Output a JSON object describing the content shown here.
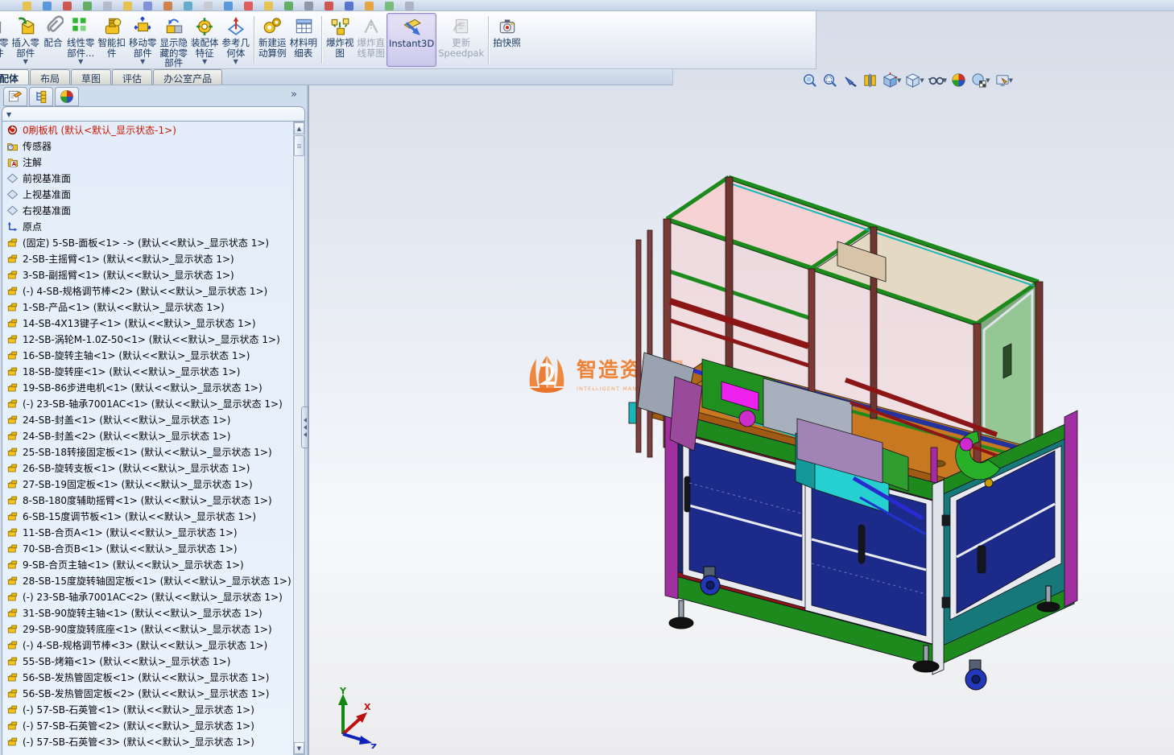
{
  "app": {
    "name": "SolidWorks assembly window"
  },
  "toolbar": {
    "buttons": [
      {
        "label": "编辑零部件",
        "display": "编辑零\n部件",
        "icon": "edit-component-icon",
        "state": "normal",
        "dropdown": false,
        "cut": true
      },
      {
        "label": "插入零部件",
        "display": "插入零\n部件",
        "icon": "insert-component-icon",
        "state": "normal",
        "dropdown": true,
        "cut": false
      },
      {
        "label": "配合",
        "display": "配合",
        "icon": "mate-icon",
        "state": "normal",
        "dropdown": false,
        "cut": false
      },
      {
        "label": "线性零部件...",
        "display": "线性零\n部件...",
        "icon": "linear-pattern-icon",
        "state": "normal",
        "dropdown": true,
        "cut": false
      },
      {
        "label": "智能扣件",
        "display": "智能扣\n件",
        "icon": "smart-fasteners-icon",
        "state": "normal",
        "dropdown": false,
        "cut": false
      },
      {
        "label": "移动零部件",
        "display": "移动零\n部件",
        "icon": "move-component-icon",
        "state": "normal",
        "dropdown": true,
        "cut": false
      },
      {
        "label": "显示隐藏的零部件",
        "display": "显示隐\n藏的零\n部件",
        "icon": "show-hidden-components-icon",
        "state": "normal",
        "dropdown": false,
        "cut": false
      },
      {
        "label": "装配体特征",
        "display": "装配体\n特征",
        "icon": "assembly-features-icon",
        "state": "normal",
        "dropdown": true,
        "cut": false
      },
      {
        "label": "参考几何体",
        "display": "参考几\n何体",
        "icon": "reference-geometry-icon",
        "state": "normal",
        "dropdown": true,
        "cut": false
      },
      {
        "sep": true
      },
      {
        "label": "新建运动算例",
        "display": "新建运\n动算例",
        "icon": "motion-study-icon",
        "state": "normal",
        "dropdown": false,
        "cut": false
      },
      {
        "label": "材料明细表",
        "display": "材料明\n细表",
        "icon": "bom-icon",
        "state": "normal",
        "dropdown": false,
        "cut": false
      },
      {
        "sep": true
      },
      {
        "label": "爆炸视图",
        "display": "爆炸视\n图",
        "icon": "exploded-view-icon",
        "state": "normal",
        "dropdown": false,
        "cut": false
      },
      {
        "label": "爆炸直线草图",
        "display": "爆炸直\n线草图",
        "icon": "explode-line-sketch-icon",
        "state": "disabled",
        "dropdown": false,
        "cut": false
      },
      {
        "label": "Instant3D",
        "display": "Instant3D",
        "icon": "instant3d-icon",
        "state": "active",
        "dropdown": false,
        "cut": false
      },
      {
        "label": "更新Speedpak",
        "display": "更新\nSpeedpak",
        "icon": "update-speedpak-icon",
        "state": "disabled",
        "dropdown": false,
        "cut": false
      },
      {
        "sep": true
      },
      {
        "label": "拍快照",
        "display": "拍快照",
        "icon": "snapshot-icon",
        "state": "normal",
        "dropdown": false,
        "cut": false
      }
    ]
  },
  "document_tabs": {
    "items": [
      {
        "label": "装配体",
        "active": true,
        "cut": true
      },
      {
        "label": "布局",
        "active": false,
        "cut": false
      },
      {
        "label": "草图",
        "active": false,
        "cut": false
      },
      {
        "label": "评估",
        "active": false,
        "cut": false
      },
      {
        "label": "办公室产品",
        "active": false,
        "cut": false
      }
    ]
  },
  "panel": {
    "tab_icons": [
      "featuremanager-tab-icon",
      "displaymanager-tab-icon",
      "configurationmanager-tab-icon"
    ],
    "overflow_glyph": "»",
    "filter_dropdown_glyph": "▼"
  },
  "feature_tree": {
    "items": [
      {
        "icon": "assembly-rebuild-icon",
        "label": "0刷板机  (默认<默认_显示状态-1>)",
        "red": true
      },
      {
        "icon": "sensor-folder-icon",
        "label": "传感器",
        "red": false
      },
      {
        "icon": "annotations-icon",
        "label": "注解",
        "red": false
      },
      {
        "icon": "plane-icon",
        "label": "前视基准面",
        "red": false
      },
      {
        "icon": "plane-icon",
        "label": "上视基准面",
        "red": false
      },
      {
        "icon": "plane-icon",
        "label": "右视基准面",
        "red": false
      },
      {
        "icon": "origin-icon",
        "label": "原点",
        "red": false
      },
      {
        "icon": "part-icon",
        "label": "(固定) 5-SB-面板<1> -> (默认<<默认>_显示状态 1>)",
        "red": false
      },
      {
        "icon": "part-icon",
        "label": "2-SB-主摇臂<1> (默认<<默认>_显示状态 1>)",
        "red": false
      },
      {
        "icon": "part-icon",
        "label": "3-SB-副摇臂<1> (默认<<默认>_显示状态 1>)",
        "red": false
      },
      {
        "icon": "part-icon",
        "label": "(-) 4-SB-规格调节棒<2> (默认<<默认>_显示状态 1>)",
        "red": false
      },
      {
        "icon": "part-icon",
        "label": "1-SB-产品<1> (默认<<默认>_显示状态 1>)",
        "red": false
      },
      {
        "icon": "part-icon",
        "label": "14-SB-4X13键子<1> (默认<<默认>_显示状态 1>)",
        "red": false
      },
      {
        "icon": "part-icon",
        "label": "12-SB-涡轮M-1.0Z-50<1> (默认<<默认>_显示状态 1>)",
        "red": false
      },
      {
        "icon": "part-icon",
        "label": "16-SB-旋转主轴<1> (默认<<默认>_显示状态 1>)",
        "red": false
      },
      {
        "icon": "part-icon",
        "label": "18-SB-旋转座<1> (默认<<默认>_显示状态 1>)",
        "red": false
      },
      {
        "icon": "part-icon",
        "label": "19-SB-86步进电机<1> (默认<<默认>_显示状态 1>)",
        "red": false
      },
      {
        "icon": "part-icon",
        "label": "(-) 23-SB-轴承7001AC<1> (默认<<默认>_显示状态 1>)",
        "red": false
      },
      {
        "icon": "part-icon",
        "label": "24-SB-封盖<1> (默认<<默认>_显示状态 1>)",
        "red": false
      },
      {
        "icon": "part-icon",
        "label": "24-SB-封盖<2> (默认<<默认>_显示状态 1>)",
        "red": false
      },
      {
        "icon": "part-icon",
        "label": "25-SB-18转接固定板<1> (默认<<默认>_显示状态 1>)",
        "red": false
      },
      {
        "icon": "part-icon",
        "label": "26-SB-旋转支板<1> (默认<<默认>_显示状态 1>)",
        "red": false
      },
      {
        "icon": "part-icon",
        "label": "27-SB-19固定板<1> (默认<<默认>_显示状态 1>)",
        "red": false
      },
      {
        "icon": "part-icon",
        "label": "8-SB-180度辅助摇臂<1> (默认<<默认>_显示状态 1>)",
        "red": false
      },
      {
        "icon": "part-icon",
        "label": "6-SB-15度调节板<1> (默认<<默认>_显示状态 1>)",
        "red": false
      },
      {
        "icon": "part-icon",
        "label": "11-SB-合页A<1> (默认<<默认>_显示状态 1>)",
        "red": false
      },
      {
        "icon": "part-icon",
        "label": "70-SB-合页B<1> (默认<<默认>_显示状态 1>)",
        "red": false
      },
      {
        "icon": "part-icon",
        "label": "9-SB-合页主轴<1> (默认<<默认>_显示状态 1>)",
        "red": false
      },
      {
        "icon": "part-icon",
        "label": "28-SB-15度旋转轴固定板<1> (默认<<默认>_显示状态 1>)",
        "red": false
      },
      {
        "icon": "part-icon",
        "label": "(-) 23-SB-轴承7001AC<2> (默认<<默认>_显示状态 1>)",
        "red": false
      },
      {
        "icon": "part-icon",
        "label": "31-SB-90旋转主轴<1> (默认<<默认>_显示状态 1>)",
        "red": false
      },
      {
        "icon": "part-icon",
        "label": "29-SB-90度旋转底座<1> (默认<<默认>_显示状态 1>)",
        "red": false
      },
      {
        "icon": "part-icon",
        "label": "(-) 4-SB-规格调节棒<3> (默认<<默认>_显示状态 1>)",
        "red": false
      },
      {
        "icon": "part-icon",
        "label": "55-SB-烤箱<1> (默认<<默认>_显示状态 1>)",
        "red": false
      },
      {
        "icon": "part-icon",
        "label": "56-SB-发热管固定板<1> (默认<<默认>_显示状态 1>)",
        "red": false
      },
      {
        "icon": "part-icon",
        "label": "56-SB-发热管固定板<2> (默认<<默认>_显示状态 1>)",
        "red": false
      },
      {
        "icon": "part-icon",
        "label": "(-) 57-SB-石英管<1> (默认<<默认>_显示状态 1>)",
        "red": false
      },
      {
        "icon": "part-icon",
        "label": "(-) 57-SB-石英管<2> (默认<<默认>_显示状态 1>)",
        "red": false
      },
      {
        "icon": "part-icon",
        "label": "(-) 57-SB-石英管<3> (默认<<默认>_显示状态 1>)",
        "red": false
      }
    ]
  },
  "heads_up": {
    "icons": [
      {
        "name": "zoom-fit-icon",
        "dropdown": false
      },
      {
        "name": "zoom-area-icon",
        "dropdown": false
      },
      {
        "name": "previous-view-icon",
        "dropdown": false
      },
      {
        "name": "section-view-icon",
        "dropdown": false
      },
      {
        "name": "view-orientation-icon",
        "dropdown": true
      },
      {
        "name": "display-style-icon",
        "dropdown": true
      },
      {
        "name": "hide-show-items-icon",
        "dropdown": true
      },
      {
        "name": "edit-appearance-icon",
        "dropdown": false
      },
      {
        "name": "apply-scene-icon",
        "dropdown": true
      },
      {
        "name": "view-settings-icon",
        "dropdown": true
      }
    ]
  },
  "viewport": {
    "watermark": {
      "title": "智造资料网",
      "subtitle": "INTELLIGENT MANUFACTURING DATA"
    },
    "triad": {
      "x": "X",
      "y": "Y",
      "z": "Z"
    }
  },
  "colors": {
    "accent_active_button": "#cdc9ec",
    "tree_error_text": "#cc1400",
    "watermark_orange": "#f07a28",
    "frame_green": "#1d8a1d",
    "cabinet_navy": "#1c2a8a",
    "post_magenta": "#a030a0",
    "deck_orange": "#c87820"
  }
}
